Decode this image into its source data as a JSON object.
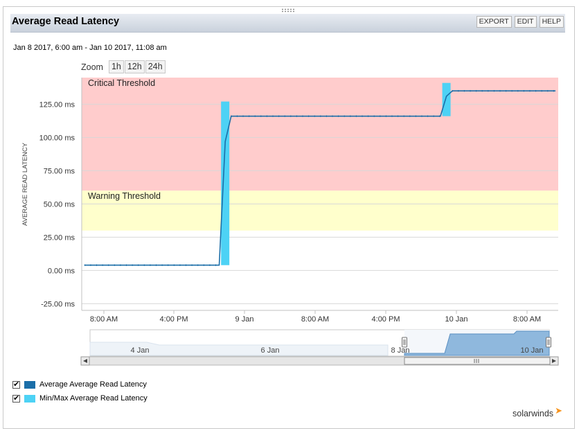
{
  "widget": {
    "title": "Average Read Latency",
    "buttons": {
      "export": "EXPORT",
      "edit": "EDIT",
      "help": "HELP"
    },
    "date_range": "Jan 8 2017, 6:00 am - Jan 10 2017, 11:08 am",
    "zoom": {
      "label": "Zoom",
      "options": [
        "1h",
        "12h",
        "24h"
      ]
    },
    "logo": "solarwinds"
  },
  "colors": {
    "critical_band": "#ffcccc",
    "warning_band": "#ffffcc",
    "avg_line": "#1a6ea8",
    "minmax_bar": "#4dd2f5",
    "navigator_fill": "#8fb8dd"
  },
  "chart_data": {
    "type": "line",
    "title": "",
    "xlabel": "",
    "ylabel": "AVERAGE READ LATENCY",
    "ylim": [
      -30,
      145
    ],
    "y_ticks": [
      -25,
      0,
      25,
      50,
      75,
      100,
      125
    ],
    "y_tick_labels": [
      "-25.00 ms",
      "0.00 ms",
      "25.00 ms",
      "50.00 ms",
      "75.00 ms",
      "100.00 ms",
      "125.00 ms"
    ],
    "xlim": [
      "Jan 8 2017 6:00 am",
      "Jan 10 2017 11:08 am"
    ],
    "x_tick_labels": [
      "8:00 AM",
      "4:00 PM",
      "9 Jan",
      "8:00 AM",
      "4:00 PM",
      "10 Jan",
      "8:00 AM"
    ],
    "thresholds": [
      {
        "label": "Critical Threshold",
        "from": 60,
        "to": 145
      },
      {
        "label": "Warning Threshold",
        "from": 30,
        "to": 60
      }
    ],
    "series": [
      {
        "name": "Average Average Read Latency",
        "points": [
          {
            "x": "Jan 8 2017 6:20 am",
            "y": 4
          },
          {
            "x": "Jan 8 2017 9:20 pm",
            "y": 4
          },
          {
            "x": "Jan 8 2017 10:00 pm",
            "y": 97
          },
          {
            "x": "Jan 8 2017 10:40 pm",
            "y": 116
          },
          {
            "x": "Jan 9 2017 10:00 pm",
            "y": 116
          },
          {
            "x": "Jan 9 2017 10:40 pm",
            "y": 131
          },
          {
            "x": "Jan 9 2017 11:20 pm",
            "y": 135
          },
          {
            "x": "Jan 10 2017 10:50 am",
            "y": 135
          }
        ]
      },
      {
        "name": "Min/Max Average Read Latency",
        "ranges": [
          {
            "x": "Jan 8 2017 10:00 pm",
            "min": 4,
            "max": 127
          },
          {
            "x": "Jan 9 2017 10:40 pm",
            "min": 116,
            "max": 141
          }
        ]
      }
    ],
    "navigator": {
      "tick_labels": [
        "4 Jan",
        "6 Jan",
        "8 Jan",
        "10 Jan"
      ]
    },
    "grid": true,
    "legend_position": "bottom-left"
  },
  "legend": [
    {
      "label": "Average Average Read Latency"
    },
    {
      "label": "Min/Max Average Read Latency"
    }
  ]
}
